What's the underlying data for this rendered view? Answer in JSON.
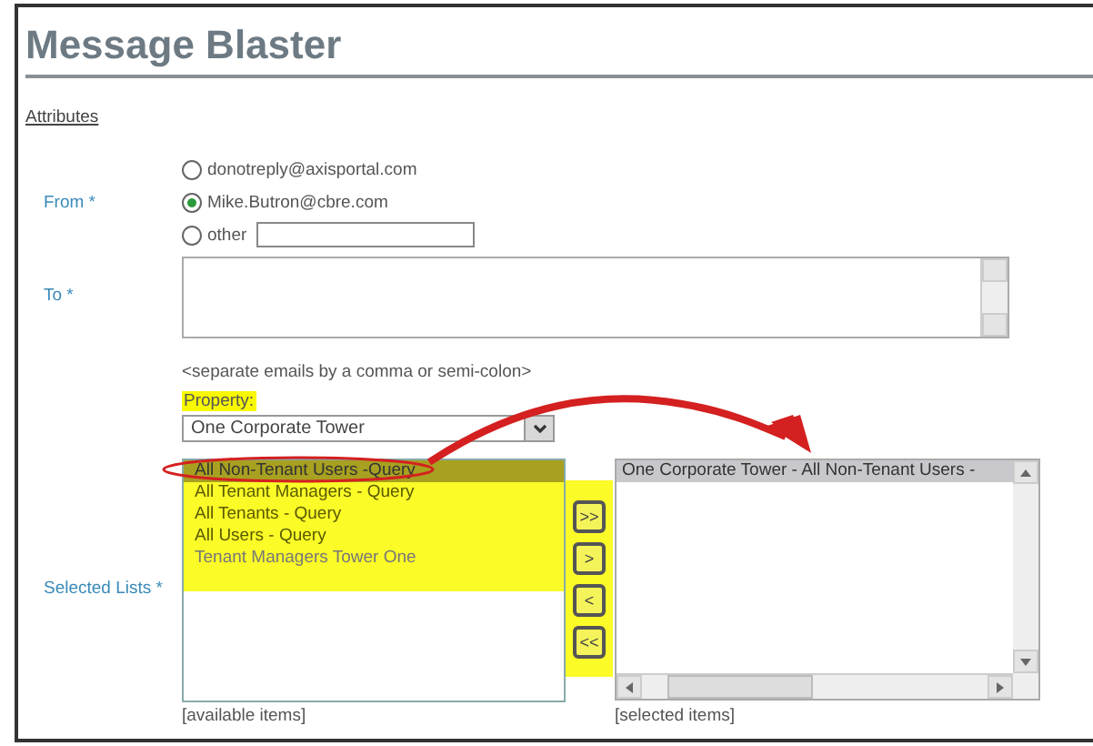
{
  "title": "Message Blaster",
  "section_link": "Attributes",
  "from": {
    "label": "From *",
    "options": [
      {
        "label": "donotreply@axisportal.com",
        "selected": false,
        "kind": "plain"
      },
      {
        "label": "Mike.Butron@cbre.com",
        "selected": true,
        "kind": "plain"
      },
      {
        "label": "other",
        "selected": false,
        "kind": "with-field"
      }
    ]
  },
  "to": {
    "label": "To *",
    "hint": "<separate emails by a comma or semi-colon>"
  },
  "property": {
    "label": "Property:",
    "value": "One Corporate Tower"
  },
  "selected_lists": {
    "label": "Selected Lists *",
    "available": [
      {
        "label": "All Non-Tenant Users -Query",
        "selected": true
      },
      {
        "label": "All Tenant Managers - Query",
        "selected": false
      },
      {
        "label": "All Tenants - Query",
        "selected": false
      },
      {
        "label": "All Users - Query",
        "selected": false
      },
      {
        "label": "Tenant Managers Tower One",
        "selected": false
      }
    ],
    "buttons": [
      ">>",
      ">",
      "<",
      "<<"
    ],
    "chosen": [
      {
        "label": "One Corporate Tower - All Non-Tenant Users -",
        "selected": true
      }
    ],
    "available_caption": "[available items]",
    "chosen_caption": "[selected items]"
  }
}
